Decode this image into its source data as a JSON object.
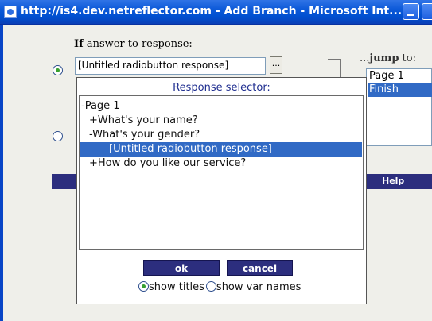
{
  "window": {
    "title": "http://is4.dev.netreflector.com - Add Branch - Microsoft Int..."
  },
  "form": {
    "if_label_bold": "If",
    "if_label_rest": " answer to response:",
    "jump_label_prefix": "...",
    "jump_label_bold": "jump",
    "jump_label_rest": " to:",
    "answer_value": "[Untitled radiobutton response]",
    "browse_label": "...",
    "page_list": [
      {
        "label": "Page 1",
        "selected": false
      },
      {
        "label": "Finish",
        "selected": true
      }
    ],
    "help_label": "Help"
  },
  "popup": {
    "title": "Response selector:",
    "tree": [
      {
        "text": "-Page 1",
        "indent": 0,
        "selected": false
      },
      {
        "text": "+What's your name?",
        "indent": 1,
        "selected": false
      },
      {
        "text": "-What's your gender?",
        "indent": 1,
        "selected": false
      },
      {
        "text": "[Untitled radiobutton response]",
        "indent": 2,
        "selected": true
      },
      {
        "text": "+How do you like our service?",
        "indent": 1,
        "selected": false
      }
    ],
    "ok_label": "ok",
    "cancel_label": "cancel",
    "option_titles": "show titles",
    "option_varnames": "show var names",
    "selected_option": "show titles"
  }
}
